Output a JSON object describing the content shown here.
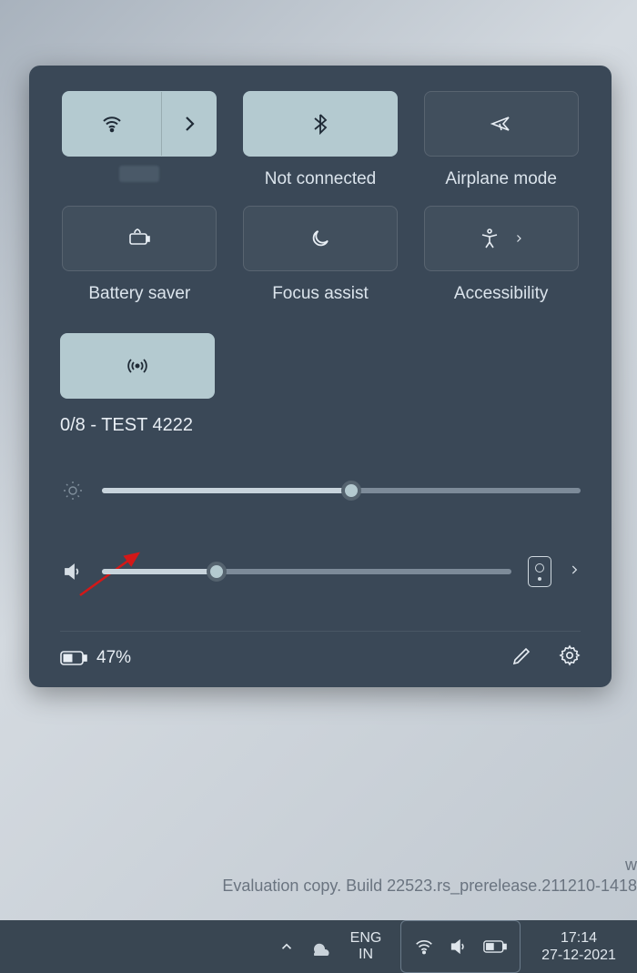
{
  "panel": {
    "tiles": {
      "wifi": {
        "label_hidden": true
      },
      "bluetooth": {
        "label": "Not connected"
      },
      "airplane": {
        "label": "Airplane mode"
      },
      "battery_saver": {
        "label": "Battery saver"
      },
      "focus_assist": {
        "label": "Focus assist"
      },
      "accessibility": {
        "label": "Accessibility"
      },
      "hotspot": {
        "label": "0/8 - TEST 4222"
      }
    },
    "brightness": {
      "value_pct": 52
    },
    "volume": {
      "value_pct": 28
    },
    "battery_pct": "47%"
  },
  "watermark": {
    "line1_suffix": "w",
    "line2": "Evaluation copy. Build 22523.rs_prerelease.211210-1418"
  },
  "taskbar": {
    "lang_top": "ENG",
    "lang_bottom": "IN",
    "time": "17:14",
    "date": "27-12-2021"
  }
}
